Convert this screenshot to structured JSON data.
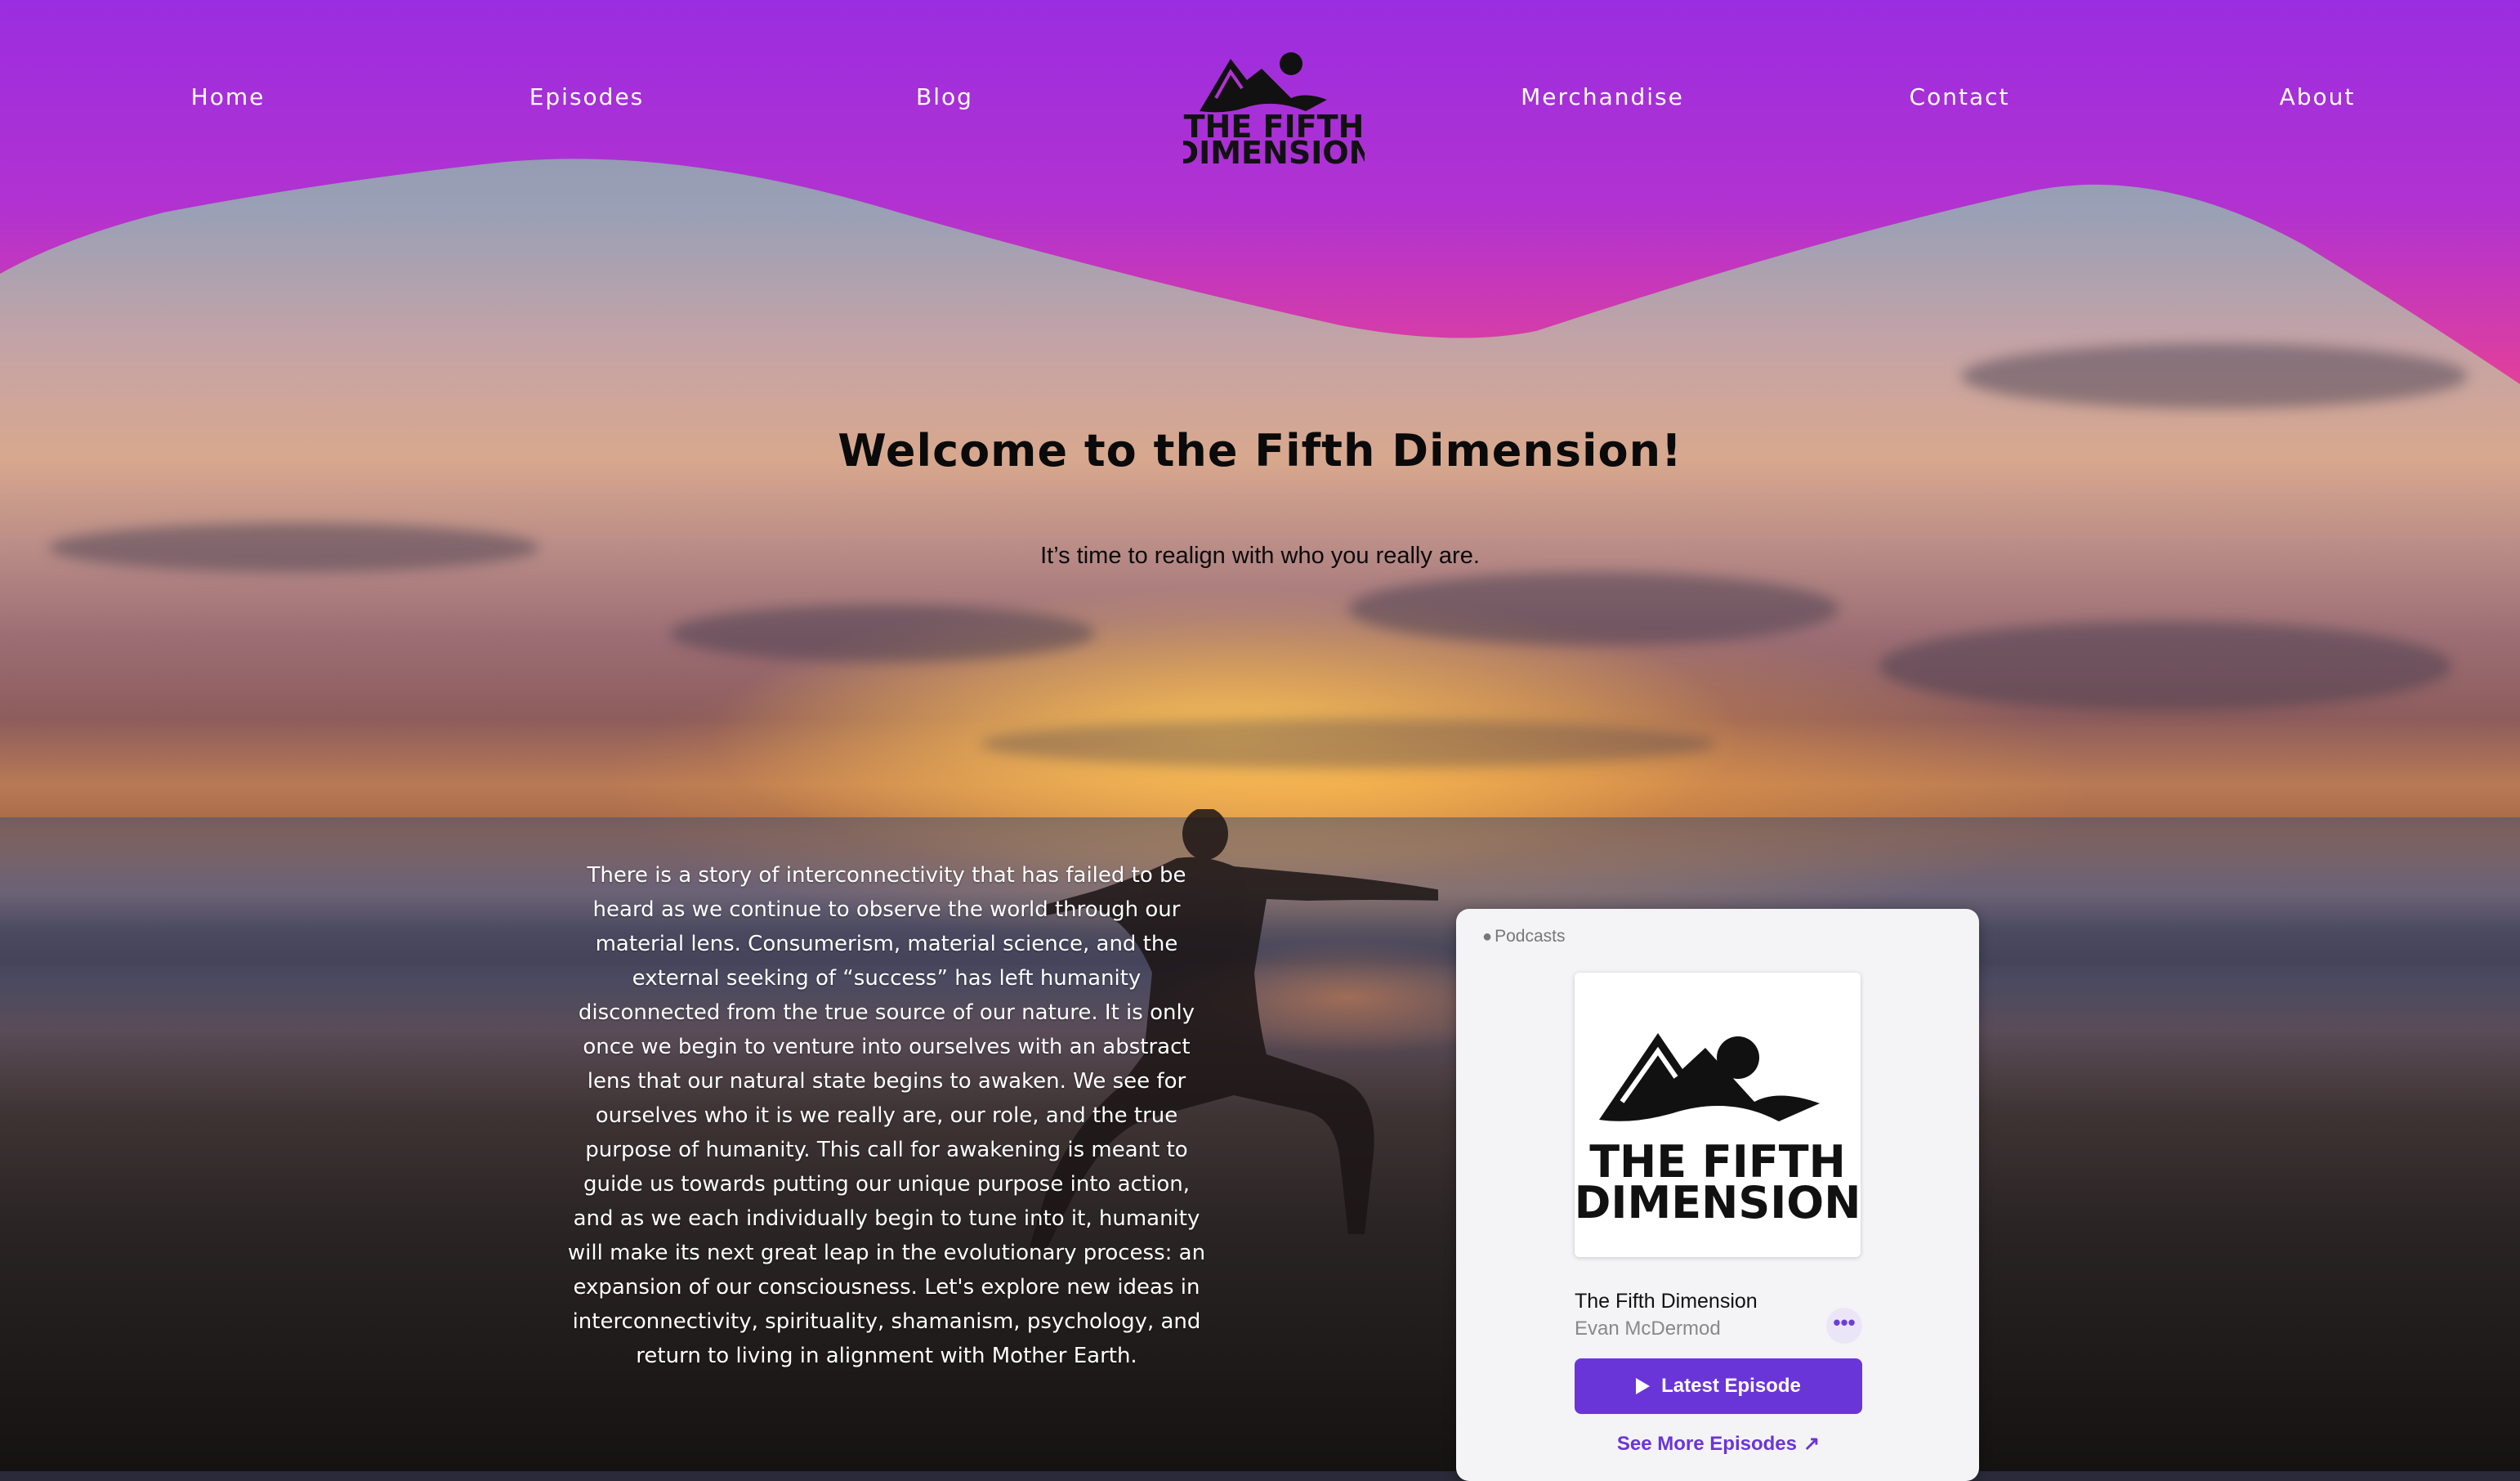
{
  "nav": {
    "items": [
      {
        "label": "Home"
      },
      {
        "label": "Episodes"
      },
      {
        "label": "Blog"
      },
      {
        "label": "Merchandise"
      },
      {
        "label": "Contact"
      },
      {
        "label": "About"
      }
    ]
  },
  "logo": {
    "line1": "THE FIFTH",
    "line2": "DIMENSION"
  },
  "hero": {
    "title": "Welcome to the Fifth Dimension!",
    "subtitle": "It’s time to realign with who you really are."
  },
  "story": {
    "text": "There is a story of interconnectivity that has failed to be heard as we continue to observe the world through our material lens. Consumerism, material science, and the external seeking of “success” has left humanity disconnected from the true source of our nature. It is only once we begin to venture into ourselves with an abstract lens that our natural state begins to awaken. We see for ourselves who it is we really are, our role, and the true purpose of humanity. This call for awakening is meant to guide us towards putting our unique purpose into action, and as we each individually begin to tune into it, humanity will make its next great leap in the evolutionary process: an expansion of our consciousness. Let's explore new ideas in interconnectivity, spirituality, shamanism, psychology, and return to living in alignment with Mother Earth."
  },
  "podcast": {
    "brand": "Podcasts",
    "brand_icon": "apple-icon",
    "show_title": "The Fifth Dimension",
    "author": "Evan McDermod",
    "more_icon": "ellipsis-icon",
    "latest_label": "Latest Episode",
    "see_more_label": "See More Episodes",
    "cover_line1": "THE FIFTH",
    "cover_line2": "DIMENSION"
  },
  "colors": {
    "header_top": "#9b2de0",
    "header_bottom": "#e2409a",
    "accent": "#6a35d8"
  }
}
